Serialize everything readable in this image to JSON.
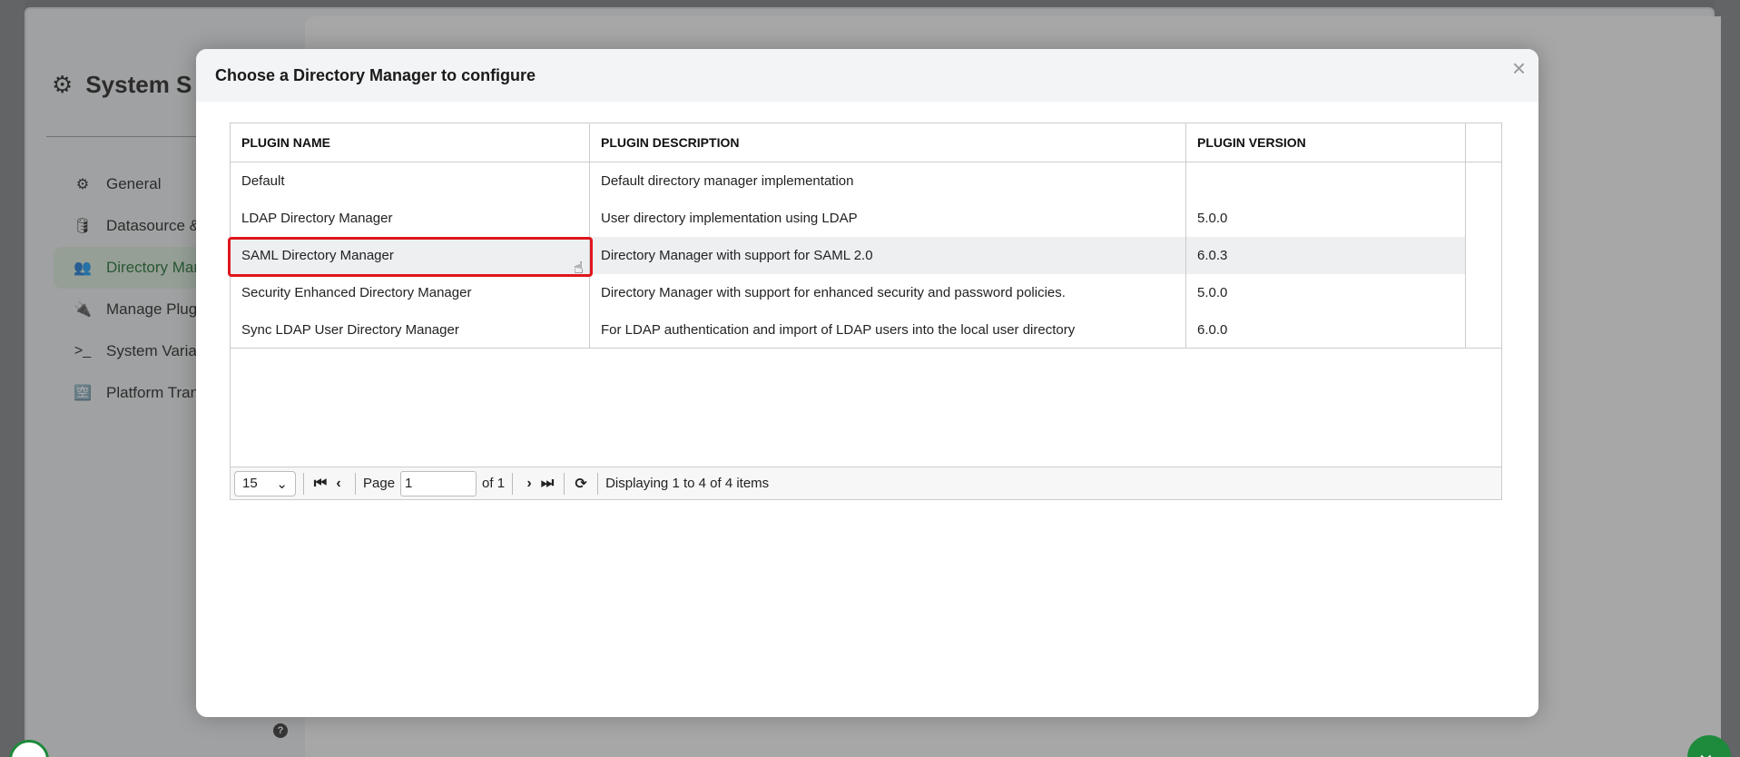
{
  "window": {
    "controls": [
      "minimize-icon",
      "pin-icon",
      "close-icon"
    ]
  },
  "sidebar": {
    "title": "System S",
    "items": [
      {
        "label": "General",
        "icon": "gear-icon",
        "active": false
      },
      {
        "label": "Datasource &",
        "icon": "database-icon",
        "active": false
      },
      {
        "label": "Directory Mar",
        "icon": "users-icon",
        "active": true
      },
      {
        "label": "Manage Plugi",
        "icon": "plug-icon",
        "active": false
      },
      {
        "label": "System Variał",
        "icon": "terminal-icon",
        "active": false
      },
      {
        "label": "Platform Tran",
        "icon": "translate-icon",
        "active": false
      }
    ]
  },
  "modal": {
    "title": "Choose a Directory Manager to configure",
    "close": "×",
    "columns": [
      "PLUGIN NAME",
      "PLUGIN DESCRIPTION",
      "PLUGIN VERSION"
    ],
    "rows": [
      {
        "name": "Default",
        "description": "Default directory manager implementation",
        "version": ""
      },
      {
        "name": "LDAP Directory Manager",
        "description": "User directory implementation using LDAP",
        "version": "5.0.0"
      },
      {
        "name": "SAML Directory Manager",
        "description": "Directory Manager with support for SAML 2.0",
        "version": "6.0.3"
      },
      {
        "name": "Security Enhanced Directory Manager",
        "description": "Directory Manager with support for enhanced security and password policies.",
        "version": "5.0.0"
      },
      {
        "name": "Sync LDAP User Directory Manager",
        "description": "For LDAP authentication and import of LDAP users into the local user directory",
        "version": "6.0.0"
      }
    ],
    "pager": {
      "page_size": "15",
      "page_label": "Page",
      "page_value": "1",
      "of_label": "of 1",
      "status": "Displaying 1 to 4 of 4 items"
    }
  },
  "colors": {
    "accent": "#1e8a3c",
    "highlight": "#e0161d",
    "active_nav_bg": "#d6e7d8"
  }
}
